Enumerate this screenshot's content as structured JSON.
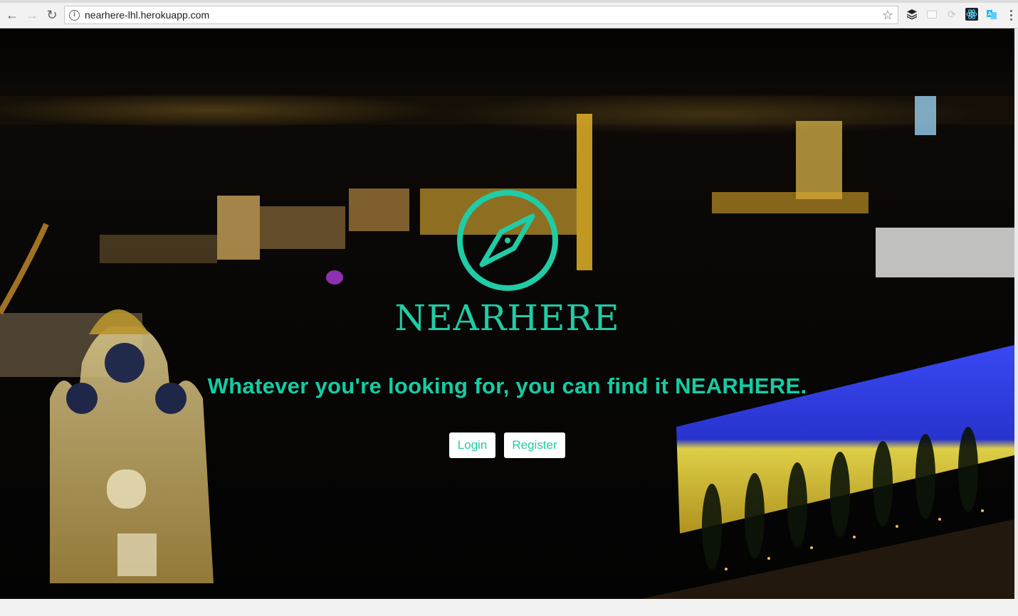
{
  "browser": {
    "url": "nearhere-lhl.herokuapp.com",
    "icons": [
      "back-icon",
      "forward-icon",
      "reload-icon",
      "info-icon",
      "star-icon",
      "buffer-extension-icon",
      "blank-extension-icon",
      "refresh-extension-icon",
      "react-devtools-icon",
      "translate-extension-icon",
      "menu-icon"
    ]
  },
  "hero": {
    "brand_name": "NEARHERE",
    "tagline": "Whatever you're looking for, you can find it NEARHERE.",
    "login_label": "Login",
    "register_label": "Register"
  },
  "colors": {
    "accent": "#1fcca6",
    "background": "#030303",
    "button_background": "#ffffff"
  }
}
